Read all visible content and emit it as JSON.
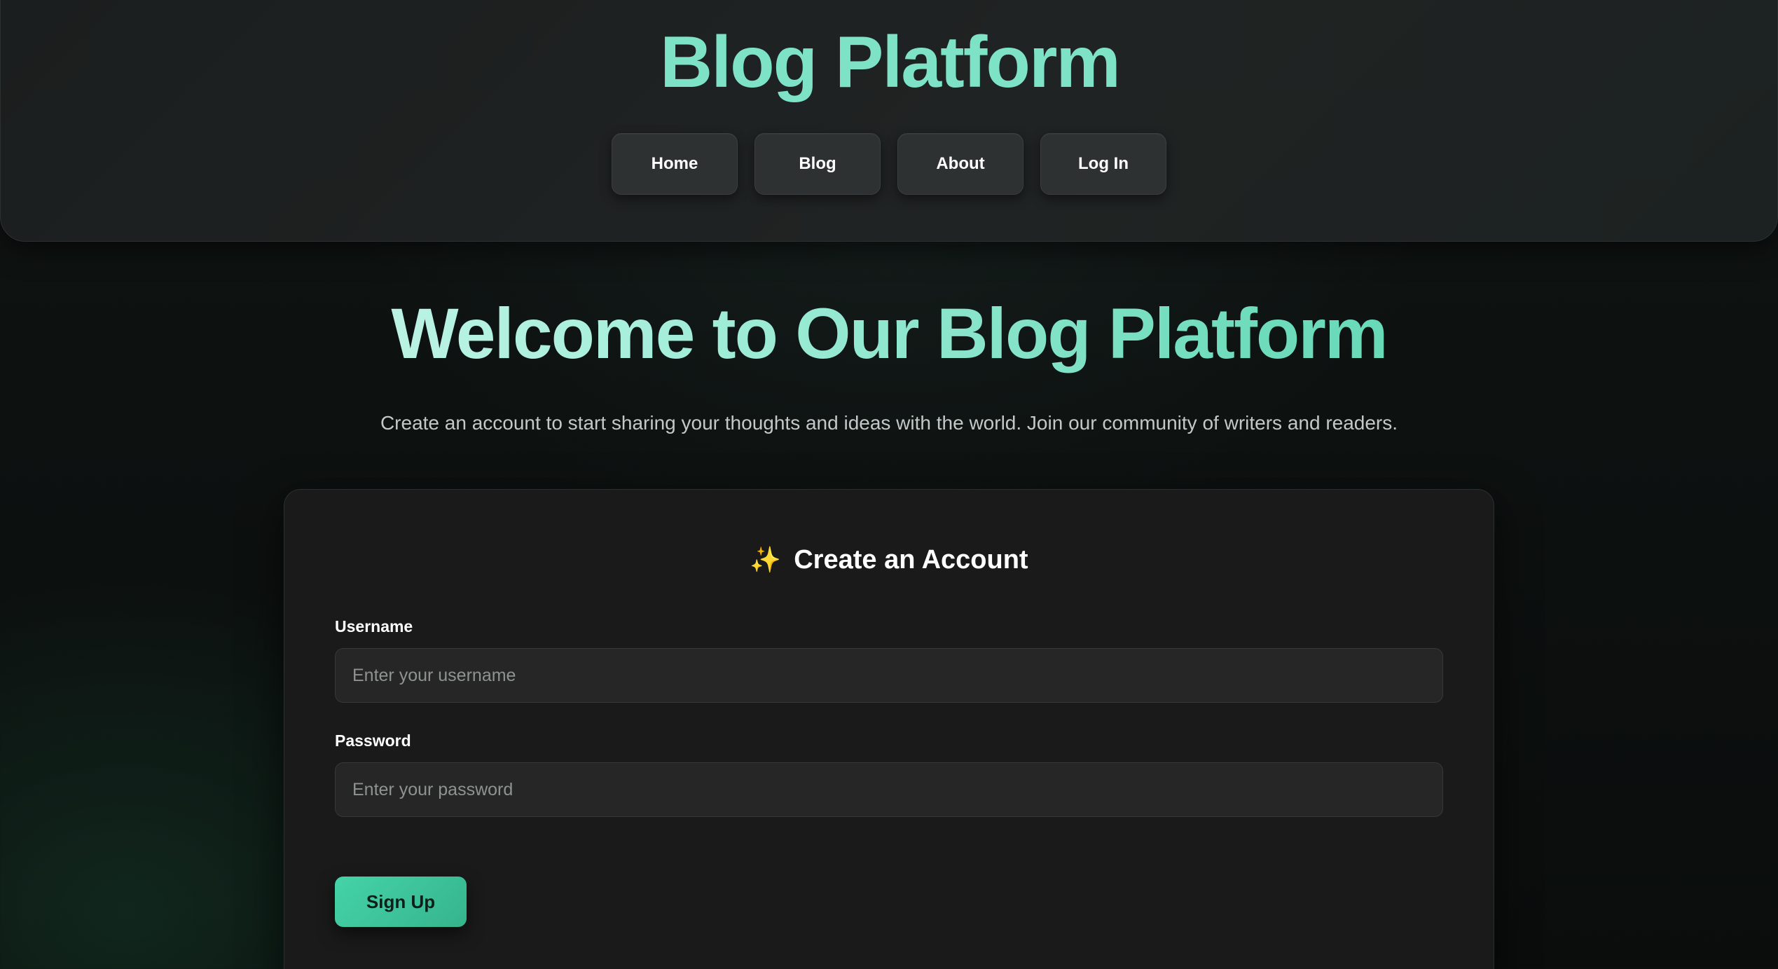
{
  "header": {
    "title": "Blog Platform",
    "nav": [
      {
        "label": "Home"
      },
      {
        "label": "Blog"
      },
      {
        "label": "About"
      },
      {
        "label": "Log In"
      }
    ]
  },
  "hero": {
    "title": "Welcome to Our Blog Platform",
    "subtitle": "Create an account to start sharing your thoughts and ideas with the world. Join our community of writers and readers."
  },
  "signup_form": {
    "heading_icon": "sparkle-icon",
    "heading_icon_glyph": "✨",
    "heading": "Create an Account",
    "username_label": "Username",
    "username_value": "",
    "username_placeholder": "Enter your username",
    "password_label": "Password",
    "password_value": "",
    "password_placeholder": "Enter your password",
    "submit_label": "Sign Up"
  },
  "colors": {
    "accent": "#56d3ae",
    "title_accent": "#7ee3c6",
    "button_gradient_start": "#45d3a8",
    "button_gradient_end": "#36b48c",
    "background": "#0d1110",
    "card_background": "#1a1a1a",
    "nav_button_background": "#2d3131"
  }
}
